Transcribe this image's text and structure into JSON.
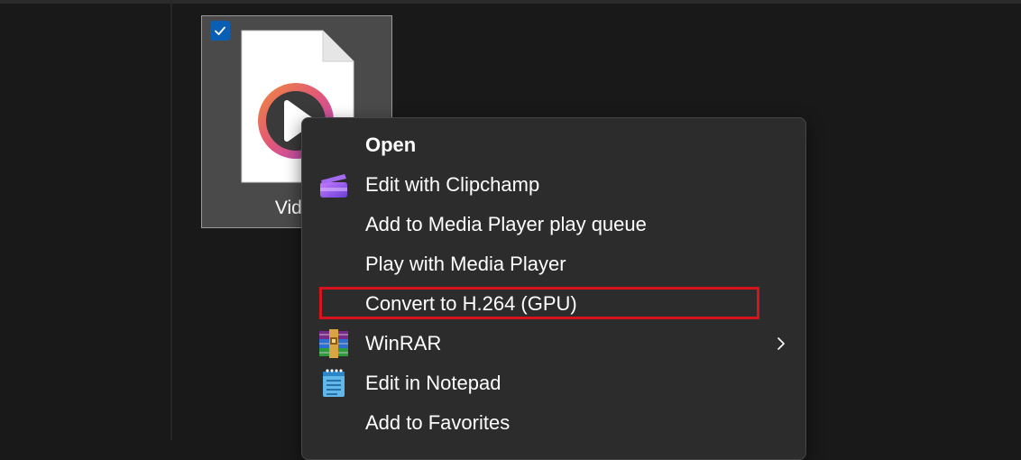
{
  "file": {
    "name": "Video.w",
    "selected": true,
    "icon": "video-file-icon"
  },
  "context_menu": {
    "items": [
      {
        "label": "Open",
        "bold": true,
        "icon": ""
      },
      {
        "label": "Edit with Clipchamp",
        "icon": "clipchamp-icon"
      },
      {
        "label": "Add to Media Player play queue",
        "icon": ""
      },
      {
        "label": "Play with Media Player",
        "icon": ""
      },
      {
        "label": "Convert to H.264 (GPU)",
        "icon": "",
        "highlighted": true
      },
      {
        "label": "WinRAR",
        "icon": "winrar-icon",
        "submenu": true
      },
      {
        "label": "Edit in Notepad",
        "icon": "notepad-icon"
      },
      {
        "label": "Add to Favorites",
        "icon": ""
      }
    ]
  },
  "colors": {
    "background": "#191919",
    "menu_background": "#2c2c2c",
    "highlight_border": "#d6141b",
    "checkbox": "#0a5fb4"
  }
}
